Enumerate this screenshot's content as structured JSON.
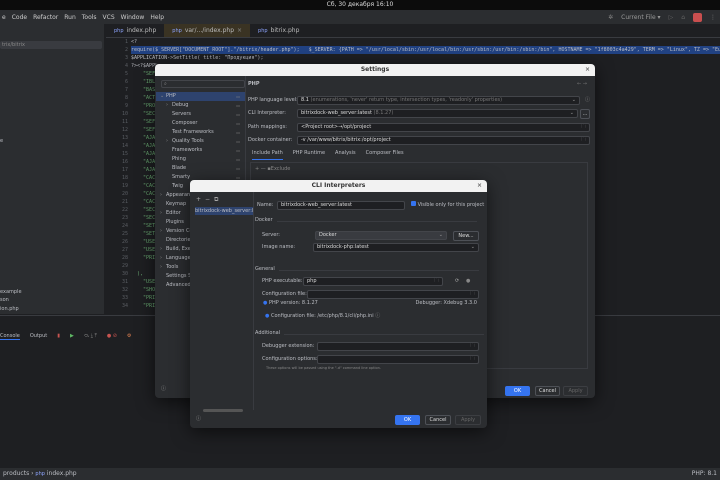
{
  "system": {
    "clock": "Сб, 30 декабря 16:10"
  },
  "menu": [
    "e",
    "Code",
    "Refactor",
    "Run",
    "Tools",
    "VCS",
    "Window",
    "Help"
  ],
  "run_config": "Current File",
  "project": {
    "search": "trix/bitrix",
    "items": [
      "e",
      "example",
      "son",
      "ion.php"
    ]
  },
  "tabs": [
    {
      "label": "index.php"
    },
    {
      "label": "var/.../index.php"
    },
    {
      "label": "bitrix.php"
    }
  ],
  "code": {
    "line_numbers": [
      "1",
      "2",
      "3",
      "4",
      "5",
      "6",
      "7",
      "8",
      "9",
      "10",
      "11",
      "12",
      "13",
      "14",
      "15",
      "16",
      "17",
      "18",
      "19",
      "20",
      "21",
      "22",
      "23",
      "24",
      "25",
      "26",
      "27",
      "28",
      "29",
      "30",
      "31",
      "32",
      "33",
      "34"
    ],
    "lines": [
      "<?",
      "require($_SERVER[\"DOCUMENT_ROOT\"].\"/bitrix/header.php\");   $_SERVER: {PATH => \"/usr/local/sbin:/usr/local/bin:/usr/sbin:/usr/bin:/sbin:/bin\", HOSTNAME => \"1f8003c4a429\", TERM => \"Linux\", TZ => \"Europe/Moscow\"",
      "$APPLICATION->SetTitle( title: \"Продукция\");",
      "?><?$APPL",
      "    \"SEF",
      "    \"IBL",
      "    \"BAS",
      "    \"ACT",
      "    \"PRO",
      "    \"SEC",
      "    \"SEF",
      "    \"SEF",
      "    \"AJA",
      "    \"AJA",
      "    \"AJA",
      "    \"AJA",
      "    \"AJA",
      "    \"CAC",
      "    \"CAC",
      "    \"CAC",
      "    \"CAC",
      "    \"SEC",
      "    \"SEC",
      "    \"SET",
      "    \"SET",
      "    \"USE",
      "    \"USE",
      "    \"PRI",
      "",
      "  ),",
      "    \"USE",
      "    \"SHO",
      "    \"PRI",
      "    \"PRI"
    ]
  },
  "bottom_panel": {
    "tabs": [
      "Console",
      "Output"
    ]
  },
  "status": {
    "breadcrumb": "products",
    "file": "index.php",
    "php": "PHP: 8.1"
  },
  "settings": {
    "title": "Settings",
    "tree": [
      {
        "label": "PHP",
        "level": 0,
        "expanded": true,
        "selected": true
      },
      {
        "label": "Debug",
        "level": 1,
        "arrow": true
      },
      {
        "label": "Servers",
        "level": 1
      },
      {
        "label": "Composer",
        "level": 1
      },
      {
        "label": "Test Frameworks",
        "level": 1
      },
      {
        "label": "Quality Tools",
        "level": 1,
        "arrow": true
      },
      {
        "label": "Frameworks",
        "level": 1
      },
      {
        "label": "Phing",
        "level": 1
      },
      {
        "label": "Blade",
        "level": 1
      },
      {
        "label": "Smarty",
        "level": 1
      },
      {
        "label": "Twig",
        "level": 1
      },
      {
        "label": "Appearance",
        "level": 0,
        "arrow": true
      },
      {
        "label": "Keymap",
        "level": 0
      },
      {
        "label": "Editor",
        "level": 0,
        "arrow": true
      },
      {
        "label": "Plugins",
        "level": 0
      },
      {
        "label": "Version Control",
        "level": 0,
        "arrow": true
      },
      {
        "label": "Directories",
        "level": 0
      },
      {
        "label": "Build, Execution",
        "level": 0,
        "arrow": true
      },
      {
        "label": "Languages",
        "level": 0,
        "arrow": true
      },
      {
        "label": "Tools",
        "level": 0,
        "arrow": true
      },
      {
        "label": "Settings Sync",
        "level": 0
      },
      {
        "label": "Advanced Settings",
        "level": 0
      }
    ],
    "header": "PHP",
    "language_level_label": "PHP language level:",
    "language_level_value": "8.1",
    "language_level_hint": "(enumerations, 'never' return type, intersection types, 'readonly' properties)",
    "cli_label": "CLI Interpreter:",
    "cli_value": "bitrixdock-web_server:latest",
    "cli_hint": "(8.1.27)",
    "path_label": "Path mappings:",
    "path_value": "<Project root>→/opt/project",
    "docker_label": "Docker container:",
    "docker_value": "-v /var/www/bitrix/bitrix:/opt/project",
    "tabs": [
      "Include Path",
      "PHP Runtime",
      "Analysis",
      "Composer Files"
    ],
    "exclude": "Exclude",
    "ok": "OK",
    "cancel": "Cancel",
    "apply": "Apply"
  },
  "cli": {
    "title": "CLI Interpreters",
    "list": [
      "bitrixdock-web_server:latest"
    ],
    "name_label": "Name:",
    "name_value": "bitrixdock-web_server:latest",
    "visible_label": "Visible only for this project",
    "visible_checked": true,
    "docker_section": "Docker",
    "server_label": "Server:",
    "server_value": "Docker",
    "new_button": "New...",
    "image_label": "Image name:",
    "image_value": "bitrixdock-php:latest",
    "general_section": "General",
    "exec_label": "PHP executable:",
    "exec_value": "php",
    "config_label": "Configuration file:",
    "php_version": "PHP version: 8.1.27",
    "debugger": "Debugger: Xdebug 3.3.0",
    "config_file": "Configuration file: /etc/php/8.1/cli/php.ini",
    "additional_section": "Additional",
    "debugger_ext_label": "Debugger extension:",
    "config_opts_label": "Configuration options:",
    "hint": "These options will be passed using the \"-d\" command line option.",
    "ok": "OK",
    "cancel": "Cancel",
    "apply": "Apply"
  }
}
